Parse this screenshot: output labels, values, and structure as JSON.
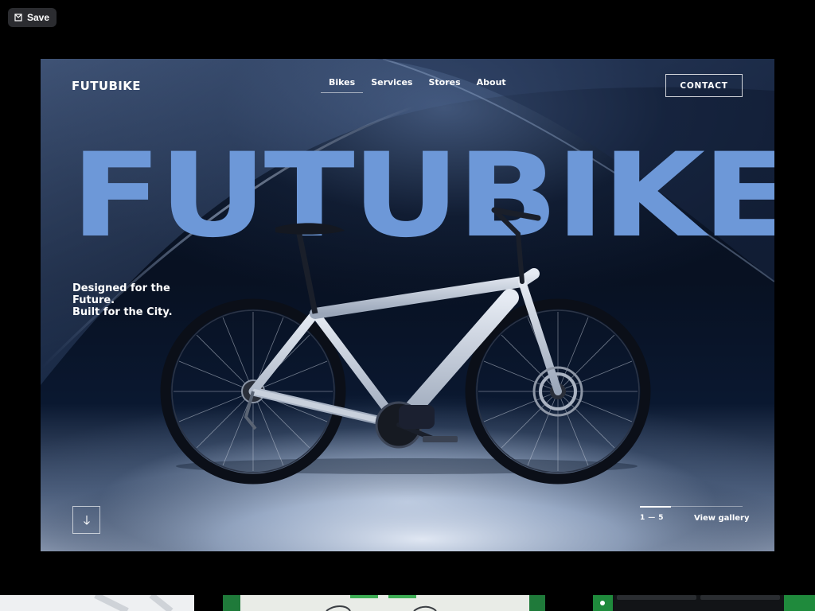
{
  "toolbar": {
    "save_label": "Save",
    "save_icon": "save-icon"
  },
  "hero": {
    "brand": "FUTUBIKE",
    "big_word": "FUTUBIKE",
    "nav": [
      {
        "label": "Bikes",
        "active": true
      },
      {
        "label": "Services",
        "active": false
      },
      {
        "label": "Stores",
        "active": false
      },
      {
        "label": "About",
        "active": false
      }
    ],
    "contact_label": "CONTACT",
    "tagline": [
      "Designed for the",
      "Future.",
      "Built for the City."
    ],
    "scroll_icon": "arrow-down-icon",
    "pager": {
      "current": "1",
      "separator": "—",
      "total": "5",
      "progress": 0.3
    },
    "gallery_label": "View gallery"
  },
  "colors": {
    "accent": "#6d98d8",
    "background": "#000000",
    "hero_dark": "#081122",
    "save_pill": "#2b2c30"
  }
}
